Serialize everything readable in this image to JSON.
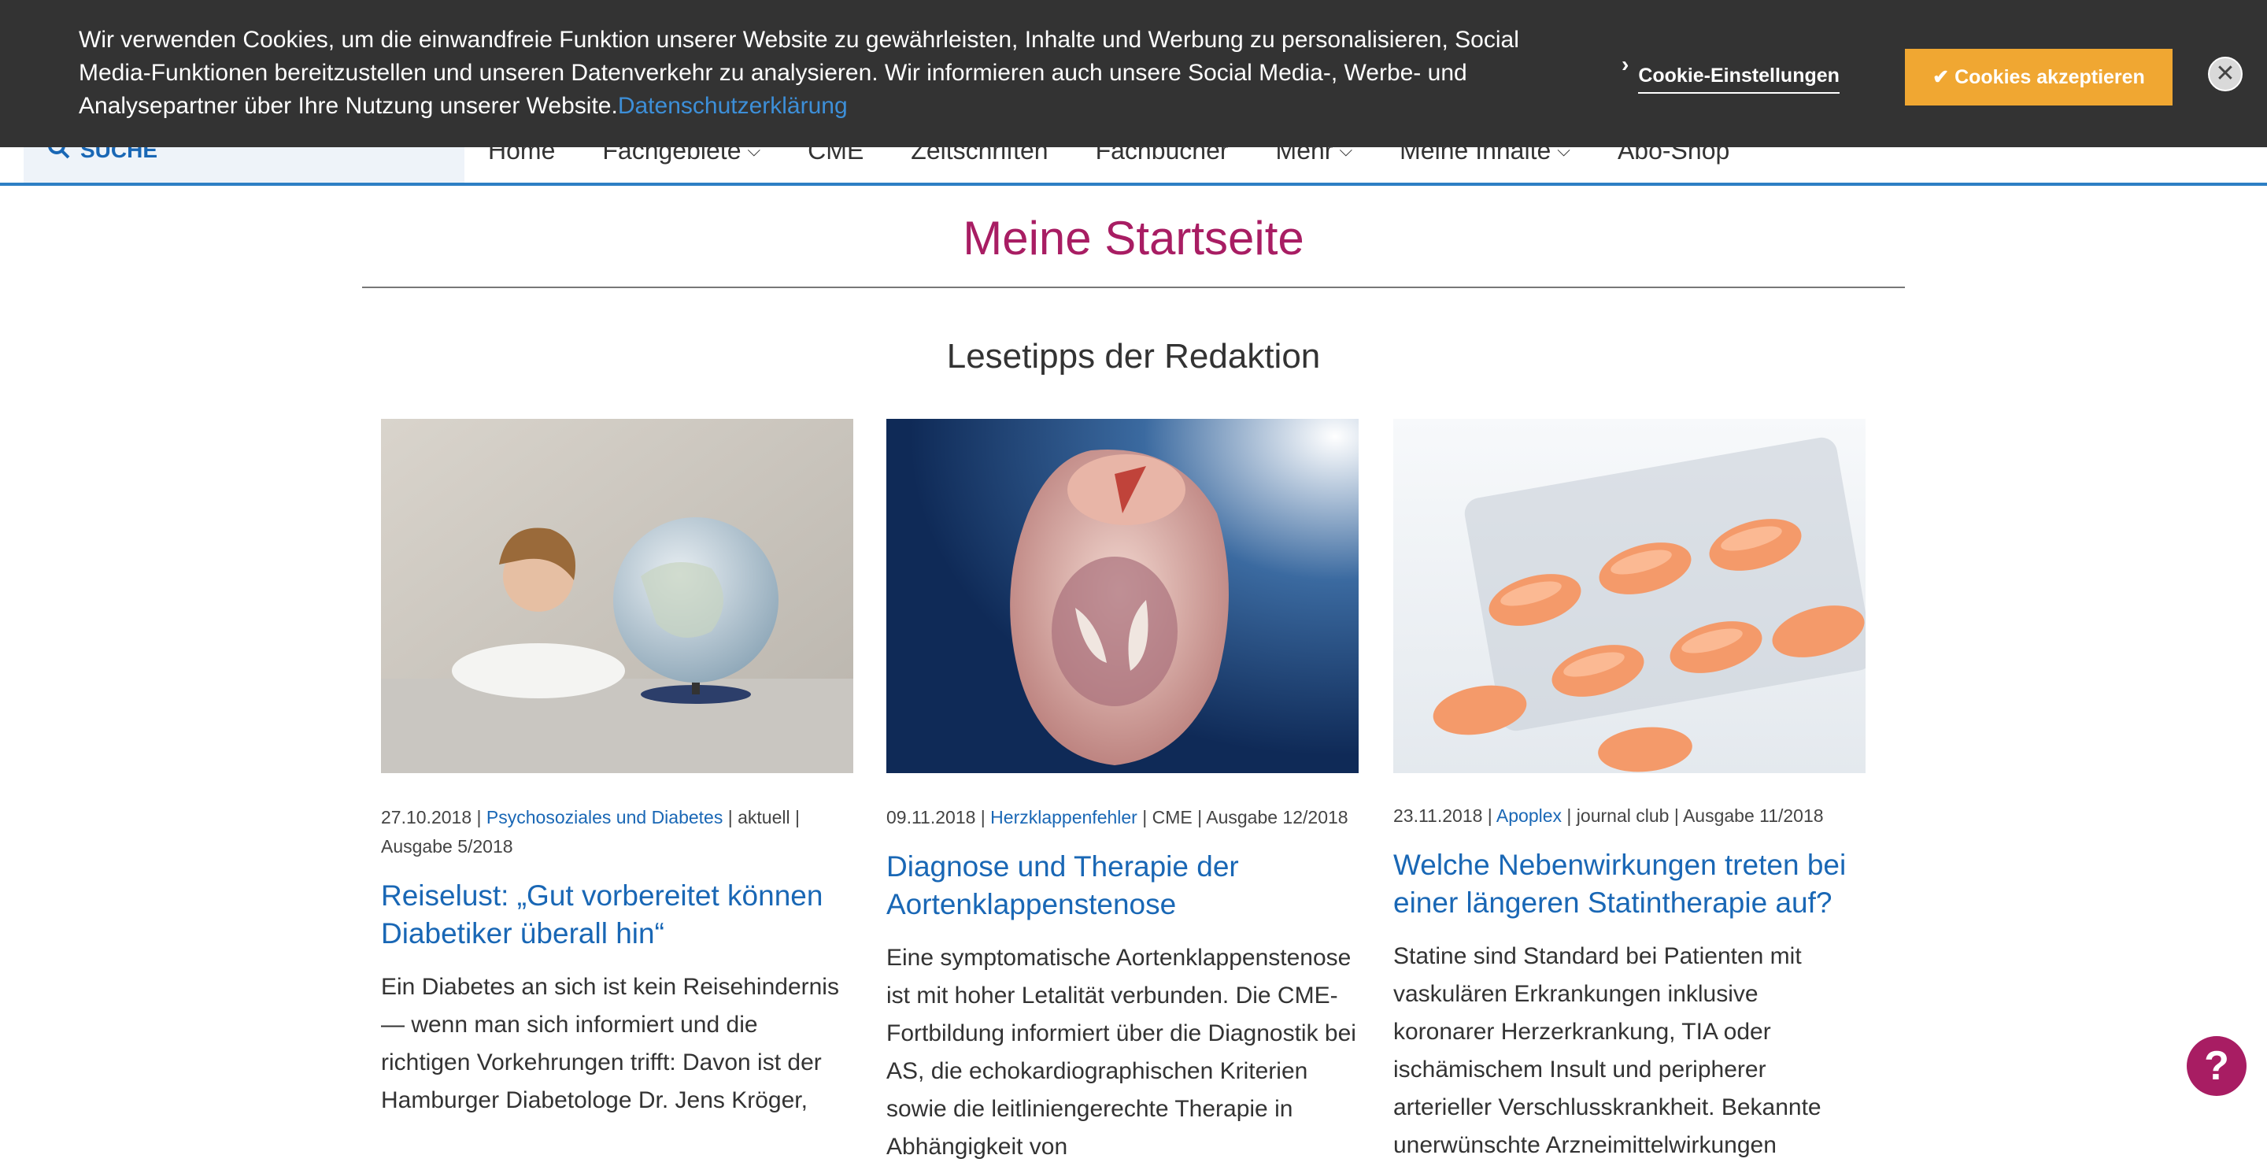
{
  "cookie_banner": {
    "text": "Wir verwenden Cookies, um die einwandfreie Funktion unserer Website zu gewährleisten, Inhalte und Werbung zu personalisieren, Social Media-Funktionen bereitzustellen und unseren Datenverkehr zu analysieren. Wir informieren auch unsere Social Media-, Werbe- und Analysepartner über Ihre Nutzung unserer Website.",
    "privacy_link": "Datenschutzerklärung",
    "settings_label": "Cookie-Einstellungen",
    "accept_label": "✔ Cookies akzeptieren",
    "close_symbol": "✕"
  },
  "nav": {
    "search_label": "SUCHE",
    "items": [
      {
        "label": "Home",
        "has_dropdown": false
      },
      {
        "label": "Fachgebiete",
        "has_dropdown": true
      },
      {
        "label": "CME",
        "has_dropdown": false
      },
      {
        "label": "Zeitschriften",
        "has_dropdown": false
      },
      {
        "label": "Fachbücher",
        "has_dropdown": false
      },
      {
        "label": "Mehr",
        "has_dropdown": true
      },
      {
        "label": "Meine Inhalte",
        "has_dropdown": true
      },
      {
        "label": "Abo-Shop",
        "has_dropdown": false
      }
    ]
  },
  "main": {
    "page_title": "Meine Startseite",
    "section_title": "Lesetipps der Redaktion",
    "cards": [
      {
        "date": "27.10.2018",
        "category": "Psychosoziales und Diabetes",
        "type": "aktuell",
        "issue": "Ausgabe 5/2018",
        "title": "Reiselust: „Gut vorbereitet können Diabetiker überall hin“",
        "text": "Ein Diabetes an sich ist kein Reisehindernis — wenn man sich informiert und die richtigen Vorkehrungen trifft: Davon ist der Hamburger Diabetologe Dr. Jens Kröger,",
        "image": "woman-with-globe"
      },
      {
        "date": "09.11.2018",
        "category": "Herzklappenfehler",
        "type": "CME",
        "issue": "Ausgabe 12/2018",
        "title": "Diagnose und Therapie der Aortenklappenstenose",
        "text": "Eine symptomatische  Aortenklappenstenose ist mit hoher Letalität verbunden. Die CME-Fortbildung informiert über die Diagnostik bei AS, die echokardiographischen Kriterien sowie die leitliniengerechte Therapie in Abhängigkeit von",
        "image": "heart-valve-model"
      },
      {
        "date": "23.11.2018",
        "category": "Apoplex",
        "type": "journal club",
        "issue": "Ausgabe 11/2018",
        "title": "Welche Nebenwirkungen treten bei einer längeren Statintherapie auf?",
        "text": "Statine sind Standard bei Patienten mit vaskulären Erkrankungen inklusive koronarer Herzerkrankung, TIA oder ischämischem Insult und peripherer arterieller Verschlusskrankheit. Bekannte unerwünschte Arzneimittelwirkungen",
        "image": "orange-pills-blister"
      }
    ]
  },
  "help_symbol": "?",
  "colors": {
    "banner_bg": "#333333",
    "accept_bg": "#f0a732",
    "title_accent": "#a81d63",
    "link_blue": "#1967b5",
    "nav_border": "#2d7fc4"
  }
}
